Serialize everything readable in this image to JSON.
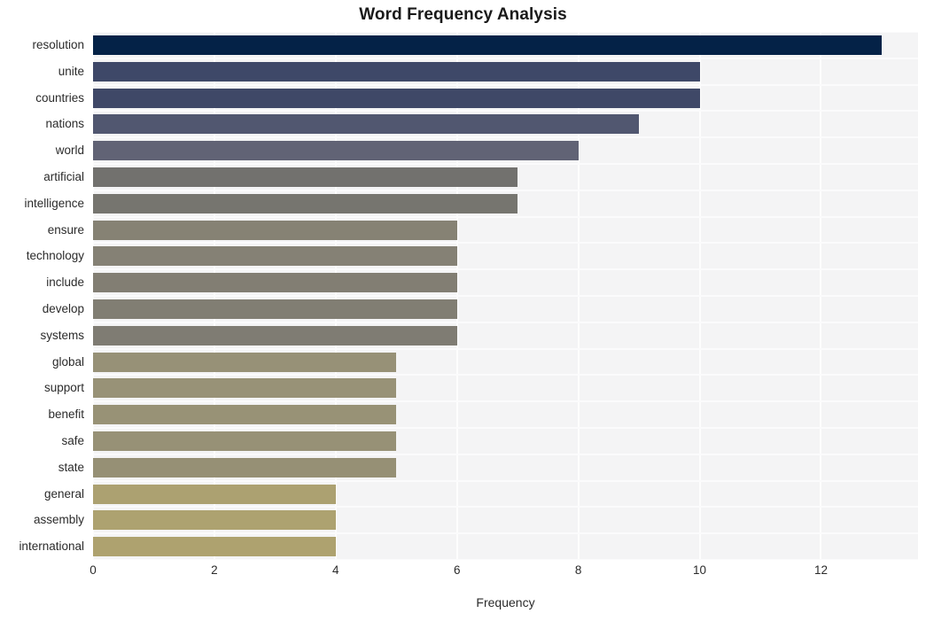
{
  "chart_data": {
    "type": "bar",
    "orientation": "horizontal",
    "title": "Word Frequency Analysis",
    "xlabel": "Frequency",
    "ylabel": "",
    "xlim": [
      0,
      13.6
    ],
    "xticks": [
      0,
      2,
      4,
      6,
      8,
      10,
      12
    ],
    "xticklabels": [
      "0",
      "2",
      "4",
      "6",
      "8",
      "10",
      "12"
    ],
    "grid": true,
    "legend": null,
    "categories": [
      "resolution",
      "unite",
      "countries",
      "nations",
      "world",
      "artificial",
      "intelligence",
      "ensure",
      "technology",
      "include",
      "develop",
      "systems",
      "global",
      "support",
      "benefit",
      "safe",
      "state",
      "general",
      "assembly",
      "international"
    ],
    "values": [
      13,
      10,
      10,
      9,
      8,
      7,
      7,
      6,
      6,
      6,
      6,
      6,
      5,
      5,
      5,
      5,
      5,
      4,
      4,
      4
    ],
    "bar_colors": [
      "#042247",
      "#3e4868",
      "#3f4867",
      "#515770",
      "#616375",
      "#72716e",
      "#76756f",
      "#868274",
      "#858175",
      "#827e73",
      "#817e73",
      "#7f7c73",
      "#979177",
      "#989277",
      "#989276",
      "#979176",
      "#969075",
      "#aca171",
      "#ada270",
      "#aea26f"
    ],
    "plot_background": "#f4f4f5",
    "gridline_color": "#fdfdfd",
    "figure_background": "#ffffff"
  }
}
